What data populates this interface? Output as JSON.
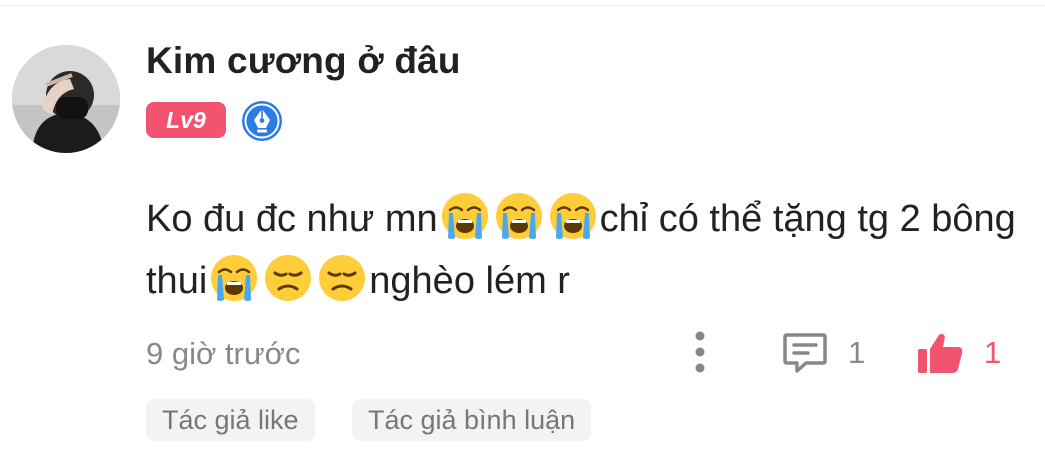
{
  "comment": {
    "username": "Kim cương ở đâu",
    "level_badge": "Lv9",
    "level_badge_color": "#f2536f",
    "author_badge_icon": "pen-nib-icon",
    "author_badge_color": "#2b7be5",
    "body": {
      "part1": "Ko đu đc như mn",
      "part2": "chỉ có thể tặng tg 2 bông thui",
      "part3": "nghèo lém r",
      "emojis": [
        "loudly-crying-face",
        "loudly-crying-face",
        "loudly-crying-face",
        "loudly-crying-face",
        "disappointed-face",
        "disappointed-face"
      ]
    },
    "timestamp": "9 giờ trước",
    "reply_count": "1",
    "like_count": "1",
    "like_color": "#f2536f",
    "tags": [
      "Tác giả like",
      "Tác giả bình luận"
    ]
  }
}
